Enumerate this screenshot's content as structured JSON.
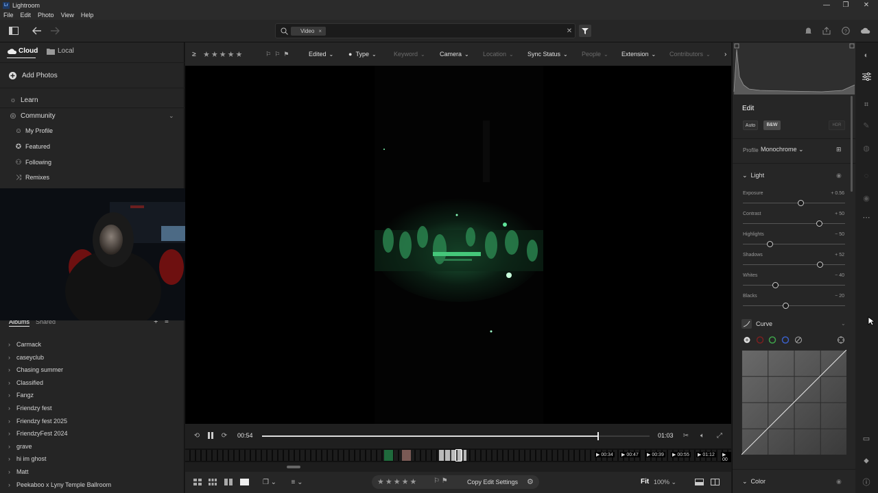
{
  "app": {
    "logo_text": "Lr",
    "window_title": "Lightroom"
  },
  "window_controls": {
    "minimize": "—",
    "restore": "❐",
    "close": "✕"
  },
  "menu": [
    "File",
    "Edit",
    "Photo",
    "View",
    "Help"
  ],
  "toolbar": {
    "search_chip": "Video",
    "search_chip_close": "×",
    "search_clear": "✕"
  },
  "left_panel": {
    "tabs": {
      "cloud": "Cloud",
      "local": "Local"
    },
    "add_photos": "Add Photos",
    "learn": "Learn",
    "community": "Community",
    "community_items": [
      "My Profile",
      "Featured",
      "Following",
      "Remixes"
    ],
    "albums_tabs": {
      "albums": "Albums",
      "shared": "Shared"
    },
    "albums": [
      "Carmack",
      "caseyclub",
      "Chasing summer",
      "Classified",
      "Fangz",
      "Friendzy fest",
      "Friendzy fest 2025",
      "FriendzyFest 2024",
      "grave",
      "hi im ghost",
      "Matt",
      "Peekaboo x Lyny Temple Ballroom"
    ]
  },
  "filter_bar": {
    "rating_op": "≥",
    "items": [
      {
        "label": "Edited",
        "dim": false
      },
      {
        "label": "Type",
        "dim": false
      },
      {
        "label": "Keyword",
        "dim": true
      },
      {
        "label": "Camera",
        "dim": false
      },
      {
        "label": "Location",
        "dim": true
      },
      {
        "label": "Sync Status",
        "dim": false
      },
      {
        "label": "People",
        "dim": true
      },
      {
        "label": "Extension",
        "dim": false
      },
      {
        "label": "Contributors",
        "dim": true
      }
    ]
  },
  "video": {
    "current_time": "00:54",
    "total_time": "01:03",
    "progress": 0.867,
    "timestamps": [
      "▶ 00:34",
      "▶ 00:47",
      "▶ 00:39",
      "▶ 00:55",
      "▶ 01:12",
      "▶ 00"
    ]
  },
  "bottom_bar": {
    "copy_edit": "Copy Edit Settings",
    "fit": "Fit",
    "zoom": "100%"
  },
  "edit_panel": {
    "title": "Edit",
    "auto": "Auto",
    "bw": "B&W",
    "hdr": "HDR",
    "profile_label": "Profile",
    "profile_value": "Monochrome",
    "light_section": "Light",
    "sliders": [
      {
        "name": "Exposure",
        "value": "+ 0.56",
        "position": 0.57
      },
      {
        "name": "Contrast",
        "value": "+ 50",
        "position": 0.75
      },
      {
        "name": "Highlights",
        "value": "− 50",
        "position": 0.27
      },
      {
        "name": "Shadows",
        "value": "+ 52",
        "position": 0.76
      },
      {
        "name": "Whites",
        "value": "− 40",
        "position": 0.32
      },
      {
        "name": "Blacks",
        "value": "− 20",
        "position": 0.42
      }
    ],
    "curve_section": "Curve",
    "color_section": "Color"
  },
  "colors": {
    "accent_green": "#3ddc84",
    "panel_bg": "#262626",
    "viewer_bg": "#000000"
  }
}
